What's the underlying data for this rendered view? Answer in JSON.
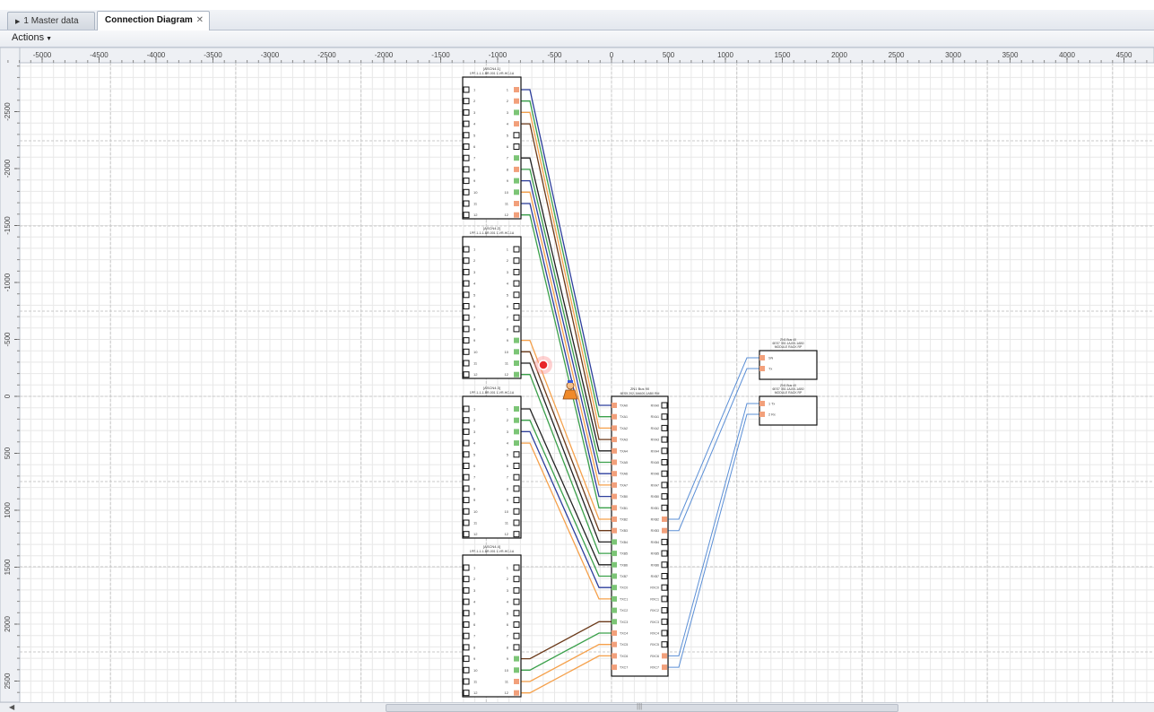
{
  "tabs": [
    {
      "label": "1 Master data",
      "active": false
    },
    {
      "label": "Connection Diagram",
      "active": true
    }
  ],
  "actions_label": "Actions",
  "ruler": {
    "x_ticks": [
      "-5000",
      "-4500",
      "-4000",
      "-3500",
      "-3000",
      "-2500",
      "-2000",
      "-1500",
      "-1000",
      "-500",
      "0",
      "500",
      "1000",
      "1500",
      "2000",
      "2500",
      "3000",
      "3500",
      "4000",
      "4500"
    ],
    "y_ticks": [
      "-2500",
      "-2000",
      "-1500",
      "-1000",
      "-500",
      "0",
      "500",
      "1000",
      "1500",
      "2000",
      "2500"
    ]
  },
  "modules": [
    {
      "title_lines": [
        "[ASCN4.1]",
        "1PF-1-1-1-BR-001 1-VR-HC-1A"
      ],
      "pins": [
        "1",
        "2",
        "3",
        "4",
        "5",
        "6",
        "7",
        "8",
        "9",
        "10",
        "11",
        "12"
      ]
    },
    {
      "title_lines": [
        "[ASCN4.2]",
        "1PF-1-1-1-BR-001 1-VR-HC-1A"
      ],
      "pins": [
        "1",
        "2",
        "3",
        "4",
        "5",
        "6",
        "7",
        "8",
        "9",
        "10",
        "11",
        "12"
      ]
    },
    {
      "title_lines": [
        "[ASCN4.3]",
        "1PF-1-1-1-BR-001 1-VR-HC-1A"
      ],
      "pins": [
        "1",
        "2",
        "3",
        "4",
        "5",
        "6",
        "7",
        "8",
        "9",
        "10",
        "11",
        "12"
      ]
    },
    {
      "title_lines": [
        "[ASCN4.4]",
        "1PF-1-1-1-BR-001 1-VR-HC-1A"
      ],
      "pins": [
        "1",
        "2",
        "3",
        "4",
        "5",
        "6",
        "7",
        "8",
        "9",
        "10",
        "11",
        "12"
      ]
    }
  ],
  "central": {
    "title_lines": [
      "ZN1 Bus 90",
      "6ES5 202-1MA00-1AB0 RM"
    ],
    "left_pins": [
      "TXA0",
      "TXA1",
      "TXA2",
      "TXA3",
      "TXA4",
      "TXA5",
      "TXA6",
      "TXA7",
      "TXB0",
      "TXB1",
      "TXB2",
      "TXB3",
      "TXB4",
      "TXB5",
      "TXB6",
      "TXB7",
      "TXC0",
      "TXC1",
      "TXC2",
      "TXC3",
      "TXC4",
      "TXC5",
      "TXC6",
      "TXC7"
    ],
    "right_pins": [
      "RXA0",
      "RXA1",
      "RXA2",
      "RXA3",
      "RXA4",
      "RXA5",
      "RXA6",
      "RXA7",
      "RXB0",
      "RXB1",
      "RXB2",
      "RXB3",
      "RXB4",
      "RXB5",
      "RXB6",
      "RXB7",
      "RXC0",
      "RXC1",
      "RXC2",
      "RXC3",
      "RXC4",
      "RXC5",
      "RXC6",
      "RXC7"
    ]
  },
  "right_boxes": [
    {
      "title_lines": [
        "ZN1 Bus 40",
        "6ES7 392-1AJ00-1AB0",
        "MODULE RACK RP"
      ],
      "pins": [
        "SN",
        "Tx"
      ]
    },
    {
      "title_lines": [
        "ZN1 Bus 40",
        "6ES7 392-1AJ00-1AB0",
        "MODULE RACK RP"
      ],
      "pins": [
        "1 Tx",
        "2 Rx"
      ]
    }
  ],
  "colors": {
    "pin_green": "#7cc576",
    "pin_orange": "#f2a07b",
    "wire_blue": "#2c3e9c",
    "wire_green": "#3aa04a",
    "wire_orange": "#f5a04a",
    "wire_brown": "#6b3a1a",
    "wire_dark": "#222222",
    "wire_light_blue": "#5b8fd6",
    "cursor_red": "#e8262a"
  },
  "icons": {
    "cursor": "red-cursor-dot-icon",
    "drag": "user-drag-icon"
  }
}
